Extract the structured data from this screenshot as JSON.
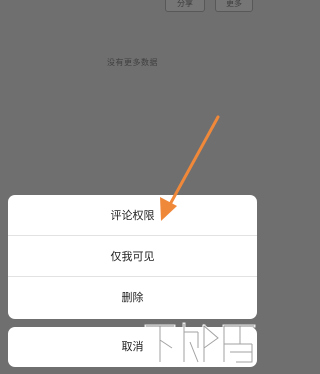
{
  "header": {
    "share_label": "分享",
    "more_label": "更多"
  },
  "content": {
    "no_more_text": "没有更多数据"
  },
  "action_sheet": {
    "items": [
      {
        "label": "评论权限"
      },
      {
        "label": "仅我可见"
      },
      {
        "label": "删除"
      }
    ],
    "cancel_label": "取消"
  },
  "annotation": {
    "arrow_color": "#f0883a"
  },
  "watermark": {
    "text": "下载吧"
  },
  "colors": {
    "overlay": "#6f6f6f",
    "sheet_bg": "#ffffff",
    "text": "#222222"
  }
}
